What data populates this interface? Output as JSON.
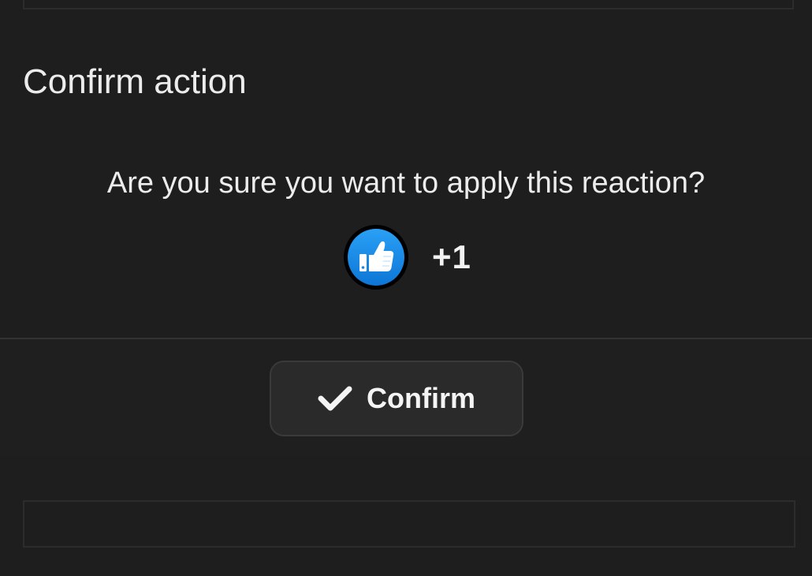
{
  "dialog": {
    "title": "Confirm action",
    "message": "Are you sure you want to apply this reaction?",
    "reaction": {
      "icon": "thumbs-up-icon",
      "label": "+1",
      "badge_color": "#1e8ff0"
    },
    "confirm_button": {
      "icon": "checkmark-icon",
      "label": "Confirm"
    }
  }
}
